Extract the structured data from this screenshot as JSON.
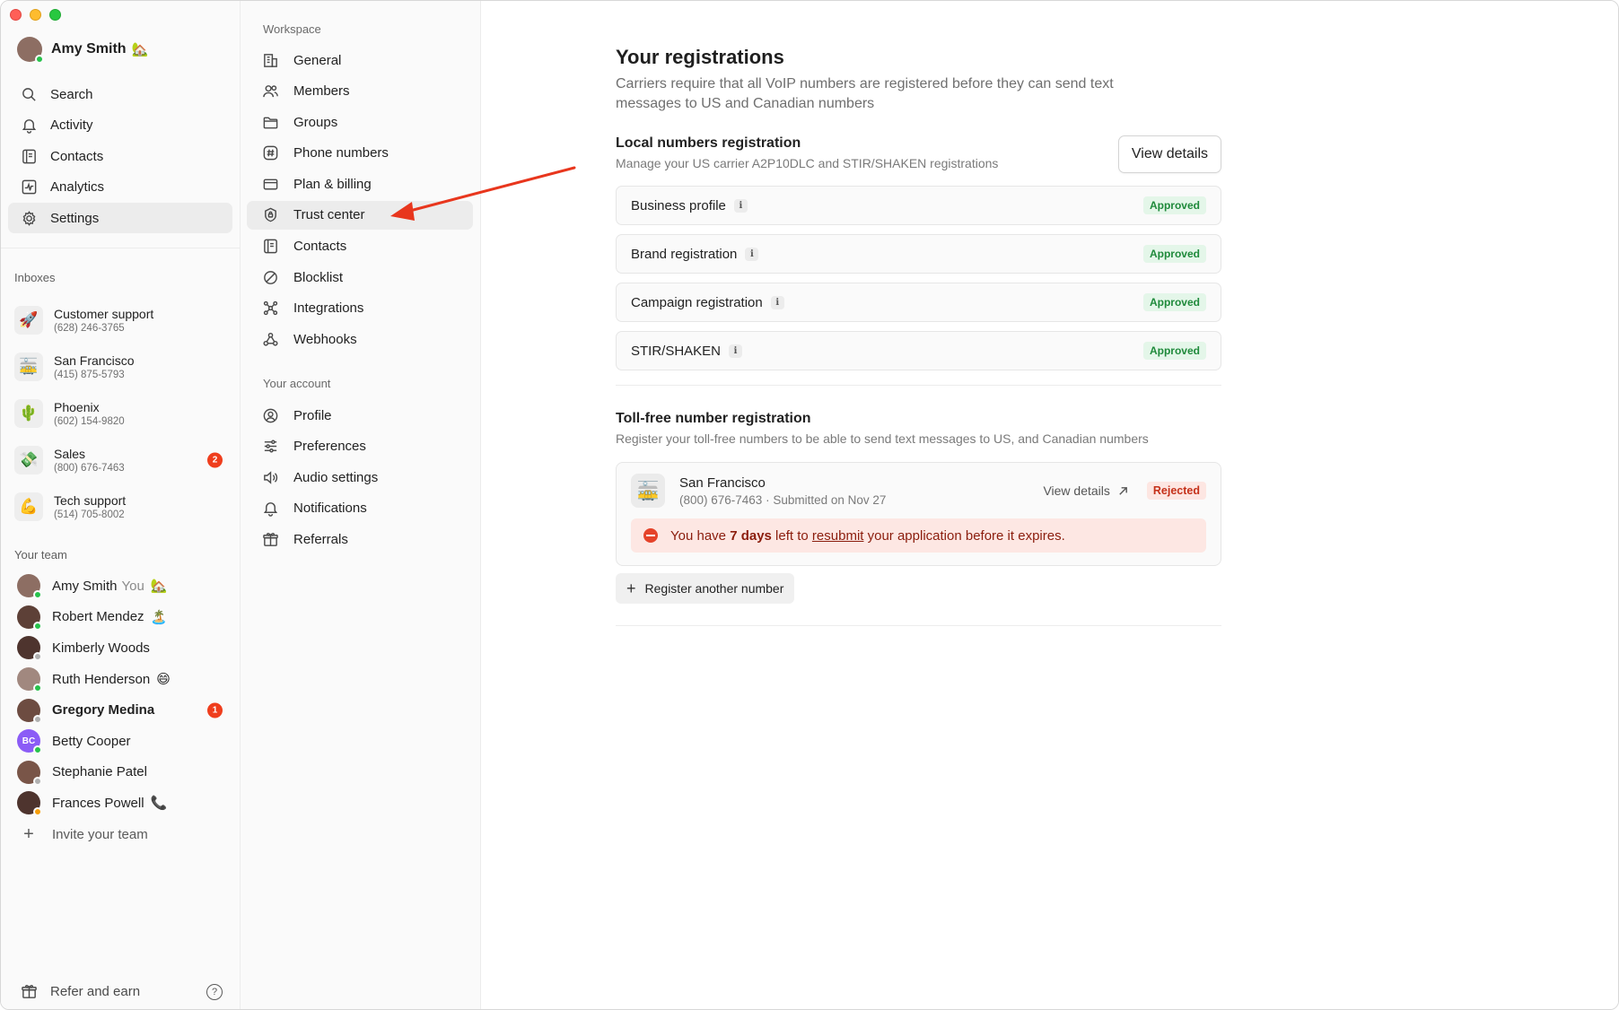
{
  "user": {
    "name": "Amy Smith",
    "status_emoji": "🏡"
  },
  "nav": [
    {
      "label": "Search",
      "icon": "search-icon"
    },
    {
      "label": "Activity",
      "icon": "bell-icon"
    },
    {
      "label": "Contacts",
      "icon": "contacts-icon"
    },
    {
      "label": "Analytics",
      "icon": "analytics-icon"
    },
    {
      "label": "Settings",
      "icon": "gear-icon",
      "active": true
    }
  ],
  "inboxes": {
    "label": "Inboxes",
    "items": [
      {
        "name": "Customer support",
        "phone": "(628) 246-3765",
        "emoji": "🚀"
      },
      {
        "name": "San Francisco",
        "phone": "(415) 875-5793",
        "emoji": "🚋"
      },
      {
        "name": "Phoenix",
        "phone": "(602) 154-9820",
        "emoji": "🌵"
      },
      {
        "name": "Sales",
        "phone": "(800) 676-7463",
        "emoji": "💸",
        "badge": "2"
      },
      {
        "name": "Tech support",
        "phone": "(514) 705-8002",
        "emoji": "💪"
      }
    ]
  },
  "team": {
    "label": "Your team",
    "you_label": "You",
    "members": [
      {
        "name": "Amy Smith",
        "emoji": "🏡",
        "you": true,
        "status": "online",
        "color": "#8d6e63"
      },
      {
        "name": "Robert Mendez",
        "emoji": "🏝️",
        "status": "online",
        "color": "#5d4037"
      },
      {
        "name": "Kimberly Woods",
        "emoji": "",
        "status": "idle",
        "color": "#4e342e"
      },
      {
        "name": "Ruth Henderson",
        "emoji": "😄",
        "status": "online",
        "color": "#a1887f"
      },
      {
        "name": "Gregory Medina",
        "emoji": "",
        "status": "idle",
        "color": "#6d4c41",
        "badge": "1",
        "bold": true
      },
      {
        "name": "Betty Cooper",
        "emoji": "",
        "status": "online",
        "color": "#8b5cf6",
        "initials": "BC"
      },
      {
        "name": "Stephanie Patel",
        "emoji": "",
        "status": "idle",
        "color": "#795548"
      },
      {
        "name": "Frances Powell",
        "emoji": "📞",
        "status": "away",
        "color": "#4e342e"
      }
    ],
    "invite_label": "Invite your team"
  },
  "footer": {
    "refer_label": "Refer and earn",
    "help_glyph": "?"
  },
  "settings_menu": {
    "workspace_label": "Workspace",
    "workspace_items": [
      {
        "label": "General",
        "icon": "building-icon"
      },
      {
        "label": "Members",
        "icon": "members-icon"
      },
      {
        "label": "Groups",
        "icon": "folder-icon"
      },
      {
        "label": "Phone numbers",
        "icon": "hash-icon"
      },
      {
        "label": "Plan & billing",
        "icon": "card-icon"
      },
      {
        "label": "Trust center",
        "icon": "shield-lock-icon",
        "active": true
      },
      {
        "label": "Contacts",
        "icon": "contacts-icon"
      },
      {
        "label": "Blocklist",
        "icon": "block-icon"
      },
      {
        "label": "Integrations",
        "icon": "integrations-icon"
      },
      {
        "label": "Webhooks",
        "icon": "webhook-icon"
      }
    ],
    "account_label": "Your account",
    "account_items": [
      {
        "label": "Profile",
        "icon": "profile-icon"
      },
      {
        "label": "Preferences",
        "icon": "sliders-icon"
      },
      {
        "label": "Audio settings",
        "icon": "speaker-icon"
      },
      {
        "label": "Notifications",
        "icon": "bell-icon"
      },
      {
        "label": "Referrals",
        "icon": "gift-icon"
      }
    ]
  },
  "main": {
    "title": "Your registrations",
    "description": "Carriers require that all VoIP numbers are registered before they can send text messages to US and Canadian numbers",
    "local": {
      "title": "Local numbers registration",
      "subtitle": "Manage your US carrier A2P10DLC and STIR/SHAKEN registrations",
      "button": "View details",
      "rows": [
        {
          "name": "Business profile",
          "status": "Approved"
        },
        {
          "name": "Brand registration",
          "status": "Approved"
        },
        {
          "name": "Campaign registration",
          "status": "Approved"
        },
        {
          "name": "STIR/SHAKEN",
          "status": "Approved"
        }
      ],
      "info_glyph": "i"
    },
    "tollfree": {
      "title": "Toll-free number registration",
      "subtitle": "Register your toll-free numbers to be able to send text messages to US, and Canadian numbers",
      "card": {
        "emoji": "🚋",
        "name": "San Francisco",
        "meta": "(800) 676-7463 · Submitted on Nov 27",
        "link": "View details",
        "status": "Rejected",
        "alert": {
          "pre": "You have ",
          "days": "7 days",
          "mid": " left to ",
          "link": "resubmit",
          "post": " your application before it expires."
        }
      },
      "add_button": "Register another number"
    }
  },
  "colors": {
    "accent_red": "#ef3e1d",
    "approved_green": "#1f8a3b",
    "rejected_red": "#c5311a",
    "arrow": "#e8361d"
  }
}
